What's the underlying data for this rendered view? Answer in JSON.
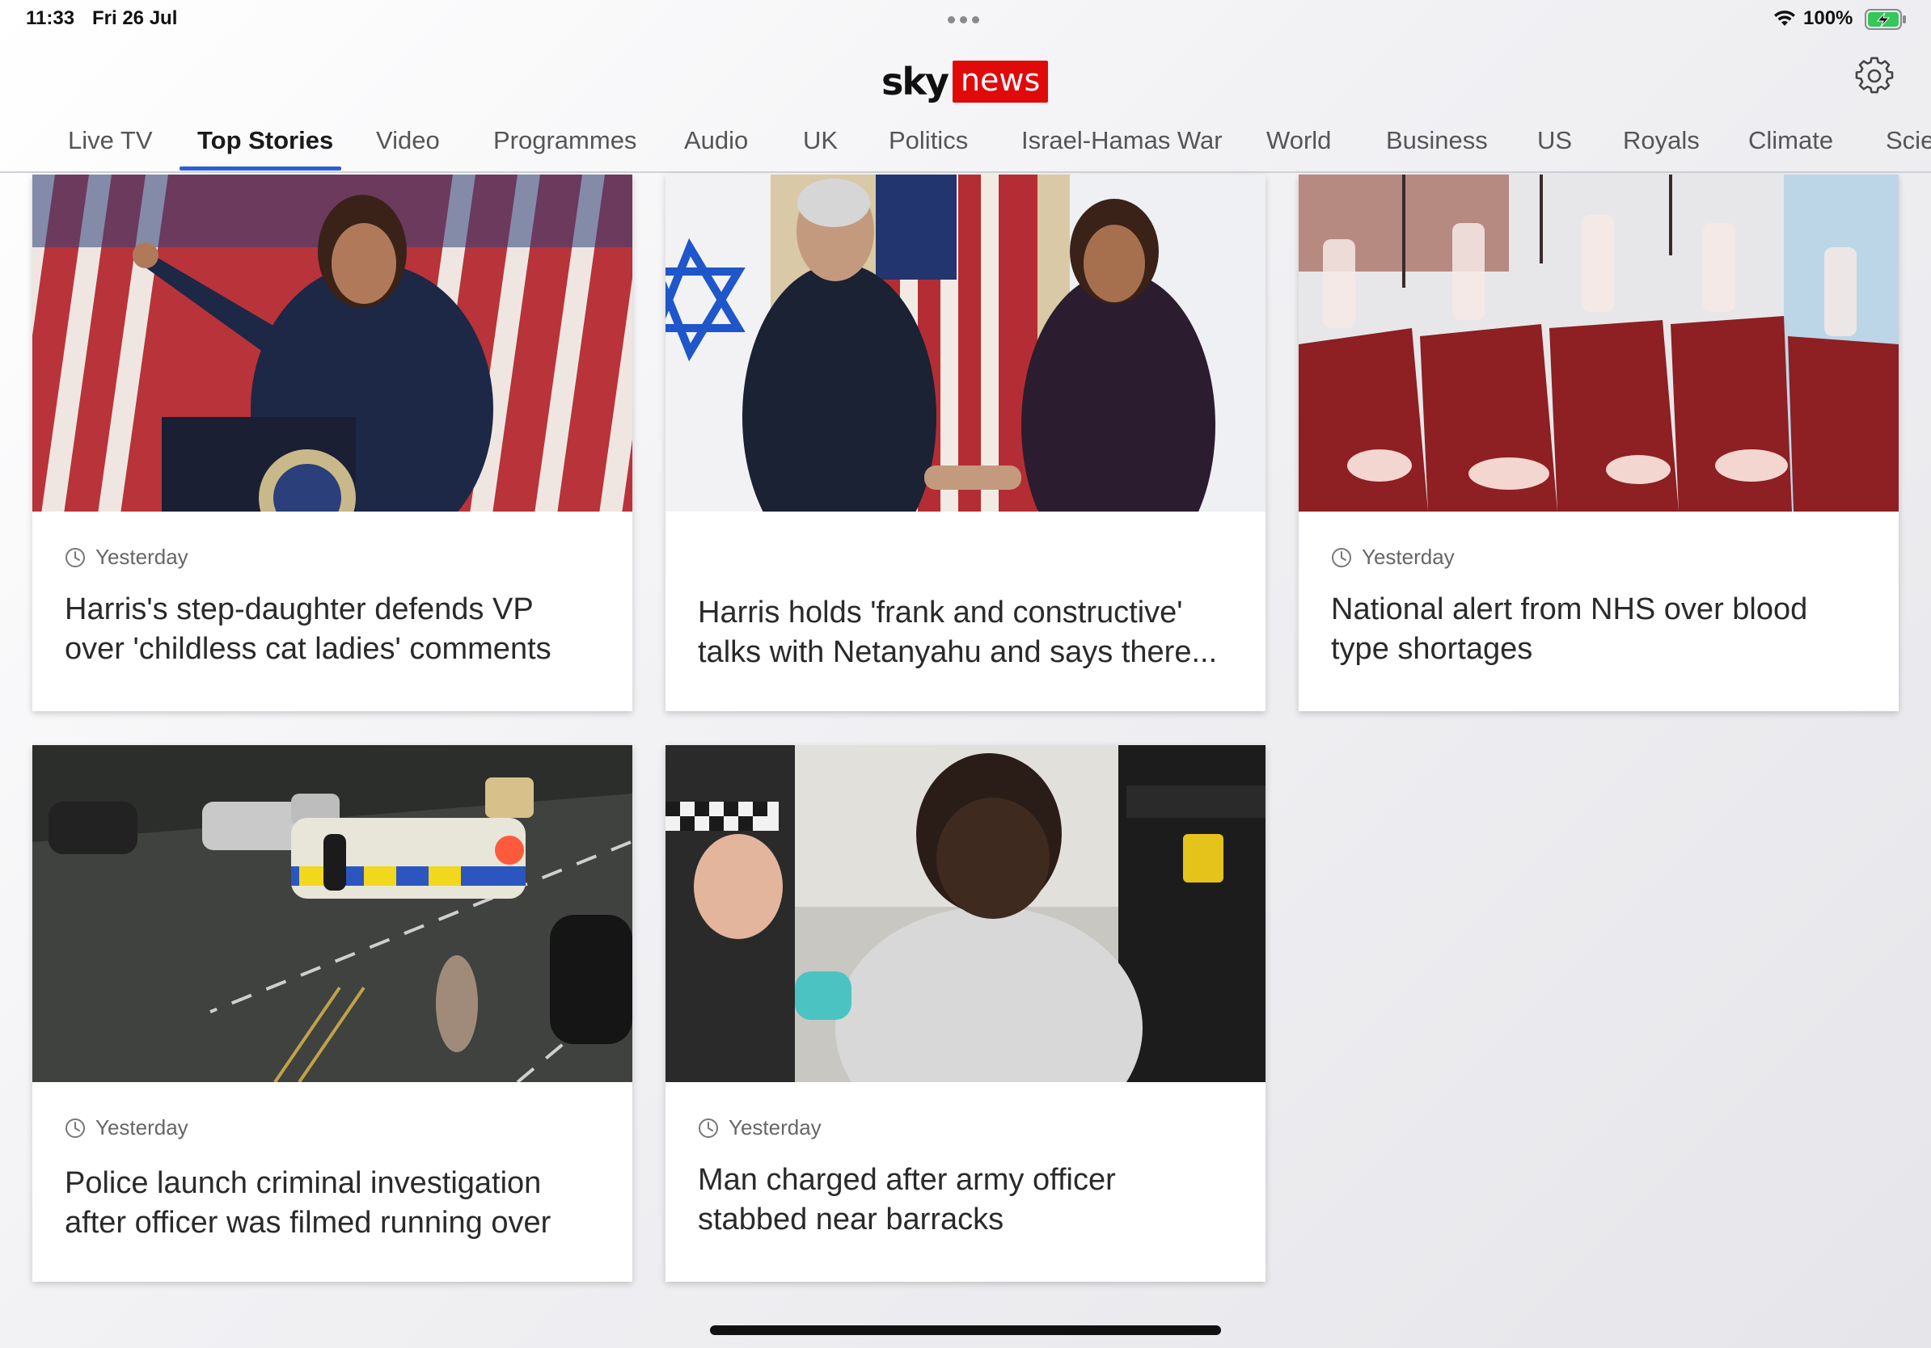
{
  "status_bar": {
    "time": "11:33",
    "date": "Fri 26 Jul",
    "battery_percent": "100%",
    "battery_level": 1.0,
    "charging": true
  },
  "header": {
    "logo_sky": "sky",
    "logo_news": "news",
    "settings_icon": "gear-icon"
  },
  "nav": {
    "active_index": 1,
    "tabs": [
      {
        "label": "Live TV"
      },
      {
        "label": "Top Stories"
      },
      {
        "label": "Video"
      },
      {
        "label": "Programmes"
      },
      {
        "label": "Audio"
      },
      {
        "label": "UK"
      },
      {
        "label": "Politics"
      },
      {
        "label": "Israel-Hamas War"
      },
      {
        "label": "World"
      },
      {
        "label": "Business"
      },
      {
        "label": "US"
      },
      {
        "label": "Royals"
      },
      {
        "label": "Climate"
      },
      {
        "label": "Scie"
      }
    ]
  },
  "stories": [
    {
      "time": "Yesterday",
      "headline": "Harris's step-daughter defends VP over 'childless cat ladies' comments",
      "image_icon": "podium-speech-photo"
    },
    {
      "time": "",
      "headline": "Harris holds 'frank and constructive' talks with Netanyahu and says there...",
      "image_icon": "handshake-flags-photo"
    },
    {
      "time": "Yesterday",
      "headline": "National alert from NHS over blood type shortages",
      "image_icon": "blood-bags-photo"
    },
    {
      "time": "Yesterday",
      "headline": "Police launch criminal investigation after officer was filmed running over c...",
      "image_icon": "police-car-night-photo"
    },
    {
      "time": "Yesterday",
      "headline": "Man charged after army officer stabbed near barracks",
      "image_icon": "arrest-photo"
    }
  ],
  "colors": {
    "accent_red": "#e10a0a",
    "tab_underline": "#2f5fd8",
    "battery_green": "#34c759"
  }
}
